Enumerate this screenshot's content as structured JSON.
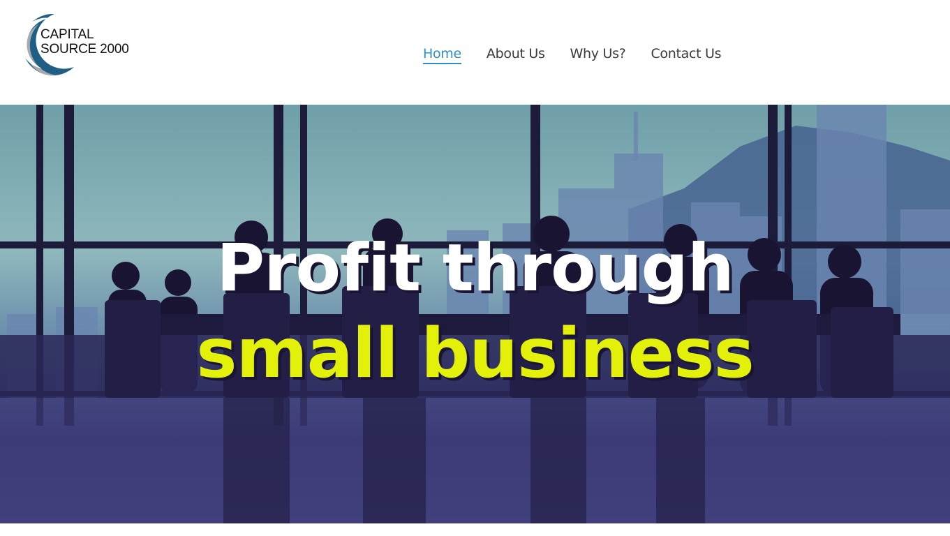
{
  "brand": {
    "line1": "CAPITAL",
    "line2": "SOURCE 2000",
    "logo_icon": "crescent-logo-icon",
    "colors": {
      "primary": "#1f5f86",
      "secondary": "#a7a9ac"
    }
  },
  "nav": {
    "items": [
      {
        "label": "Home",
        "active": true
      },
      {
        "label": "About Us",
        "active": false
      },
      {
        "label": "Why Us?",
        "active": false
      },
      {
        "label": "Contact Us",
        "active": false
      }
    ],
    "active_color": "#2f8fc4"
  },
  "hero": {
    "headline_line1": "Profit through",
    "headline_line2": "small business",
    "line1_color": "#ffffff",
    "line2_color": "#e3f00a"
  }
}
